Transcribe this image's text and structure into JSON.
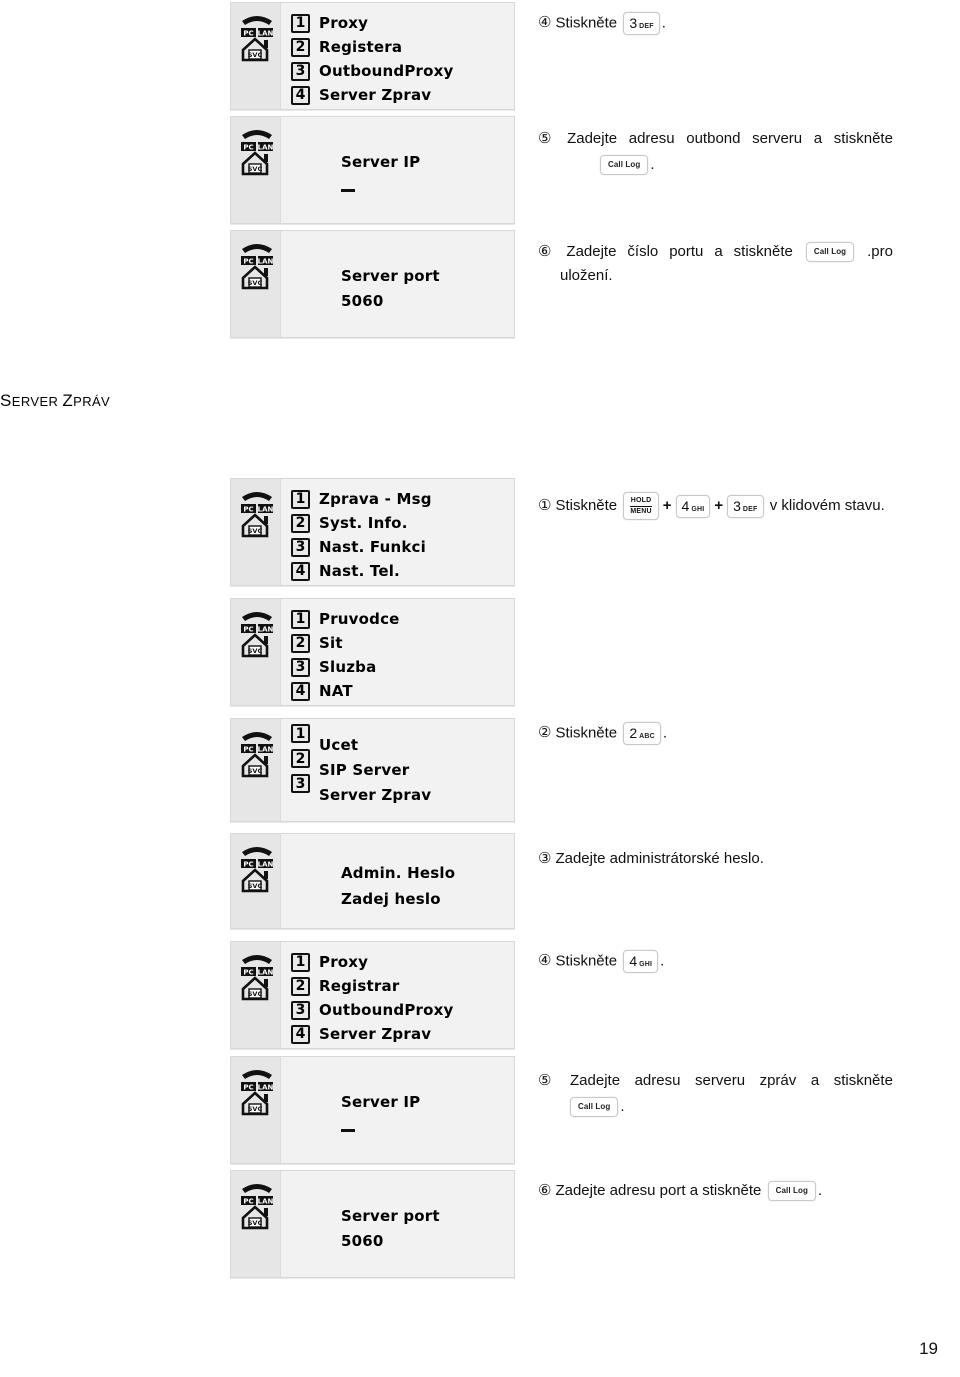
{
  "page": {
    "number": "19"
  },
  "section_heading": {
    "first_letter": "S",
    "rest_1": "ERVER",
    "space": " ",
    "first_letter_2": "Z",
    "rest_2": "PRÁV",
    "full": "SERVER ZPRÁV"
  },
  "panels": [
    {
      "id": "panel-proxy-top",
      "type": "menu",
      "items": [
        {
          "num": "1",
          "label": "Proxy"
        },
        {
          "num": "2",
          "label": "Registera"
        },
        {
          "num": "3",
          "label": "OutboundProxy"
        },
        {
          "num": "4",
          "label": "Server Zprav"
        }
      ]
    },
    {
      "id": "panel-server-ip-top",
      "type": "text",
      "lines": [
        "Server IP"
      ],
      "cursor": true
    },
    {
      "id": "panel-server-port-top",
      "type": "text",
      "lines": [
        "Server port",
        "5060"
      ],
      "cursor": false
    },
    {
      "id": "panel-main-menu",
      "type": "menu",
      "items": [
        {
          "num": "1",
          "label": "Zprava - Msg"
        },
        {
          "num": "2",
          "label": "Syst. Info."
        },
        {
          "num": "3",
          "label": "Nast. Funkci"
        },
        {
          "num": "4",
          "label": "Nast. Tel."
        }
      ]
    },
    {
      "id": "panel-nast-funkci",
      "type": "menu",
      "items": [
        {
          "num": "1",
          "label": "Pruvodce"
        },
        {
          "num": "2",
          "label": "Sit"
        },
        {
          "num": "3",
          "label": "Sluzba"
        },
        {
          "num": "4",
          "label": "NAT"
        }
      ]
    },
    {
      "id": "panel-sluzba",
      "type": "menu-offset",
      "items": [
        {
          "num": "1",
          "label": "Ucet"
        },
        {
          "num": "2",
          "label": "SIP Server"
        },
        {
          "num": "3",
          "label": "Server Zprav"
        }
      ]
    },
    {
      "id": "panel-admin-heslo",
      "type": "text",
      "lines": [
        "Admin. Heslo",
        "Zadej heslo"
      ],
      "cursor": false
    },
    {
      "id": "panel-proxy-bottom",
      "type": "menu",
      "items": [
        {
          "num": "1",
          "label": "Proxy"
        },
        {
          "num": "2",
          "label": "Registrar"
        },
        {
          "num": "3",
          "label": "OutboundProxy"
        },
        {
          "num": "4",
          "label": "Server Zprav"
        }
      ]
    },
    {
      "id": "panel-server-ip-bottom",
      "type": "text",
      "lines": [
        "Server IP"
      ],
      "cursor": true
    },
    {
      "id": "panel-server-port-bottom",
      "type": "text",
      "lines": [
        "Server port",
        "5060"
      ],
      "cursor": false
    }
  ],
  "instructions": {
    "top_step4": {
      "marker": "④",
      "verb": "Stiskněte",
      "key_digit": "3",
      "key_letters": "DEF",
      "period": "."
    },
    "top_step5": {
      "marker": "⑤",
      "words": [
        "Zadejte",
        "adresu",
        "outbond",
        "serveru",
        "a",
        "stiskněte"
      ],
      "key_label": "Call Log",
      "period": "."
    },
    "top_step6": {
      "marker": "⑥",
      "words": [
        "Zadejte",
        "číslo",
        "portu",
        "a",
        "stiskněte"
      ],
      "key_label": "Call Log",
      "tail": ".pro",
      "line2": "uložení."
    },
    "step1": {
      "marker": "①",
      "verb": "Stiskněte",
      "key_hold": "HOLD",
      "key_menu": "MENU",
      "plus": "+",
      "key2_digit": "4",
      "key2_letters": "GHI",
      "key3_digit": "3",
      "key3_letters": "DEF",
      "tail": "v klidovém stavu."
    },
    "step2": {
      "marker": "②",
      "verb": "Stiskněte",
      "key_digit": "2",
      "key_letters": "ABC",
      "period": "."
    },
    "step3": {
      "marker": "③",
      "text": "Zadejte administrátorské heslo."
    },
    "step4": {
      "marker": "④",
      "verb": "Stiskněte",
      "key_digit": "4",
      "key_letters": "GHI",
      "period": "."
    },
    "step5": {
      "marker": "⑤",
      "words": [
        "Zadejte",
        "adresu",
        "serveru",
        "zpráv",
        "a",
        "stiskněte"
      ],
      "key_label": "Call Log",
      "period": "."
    },
    "step6": {
      "marker": "⑥",
      "text": "Zadejte adresu port a stiskněte",
      "key_label": "Call Log",
      "period": "."
    }
  },
  "icons": {
    "handset": "handset-icon",
    "pc": "PC",
    "lan": "LAN",
    "svc": "SVC"
  }
}
